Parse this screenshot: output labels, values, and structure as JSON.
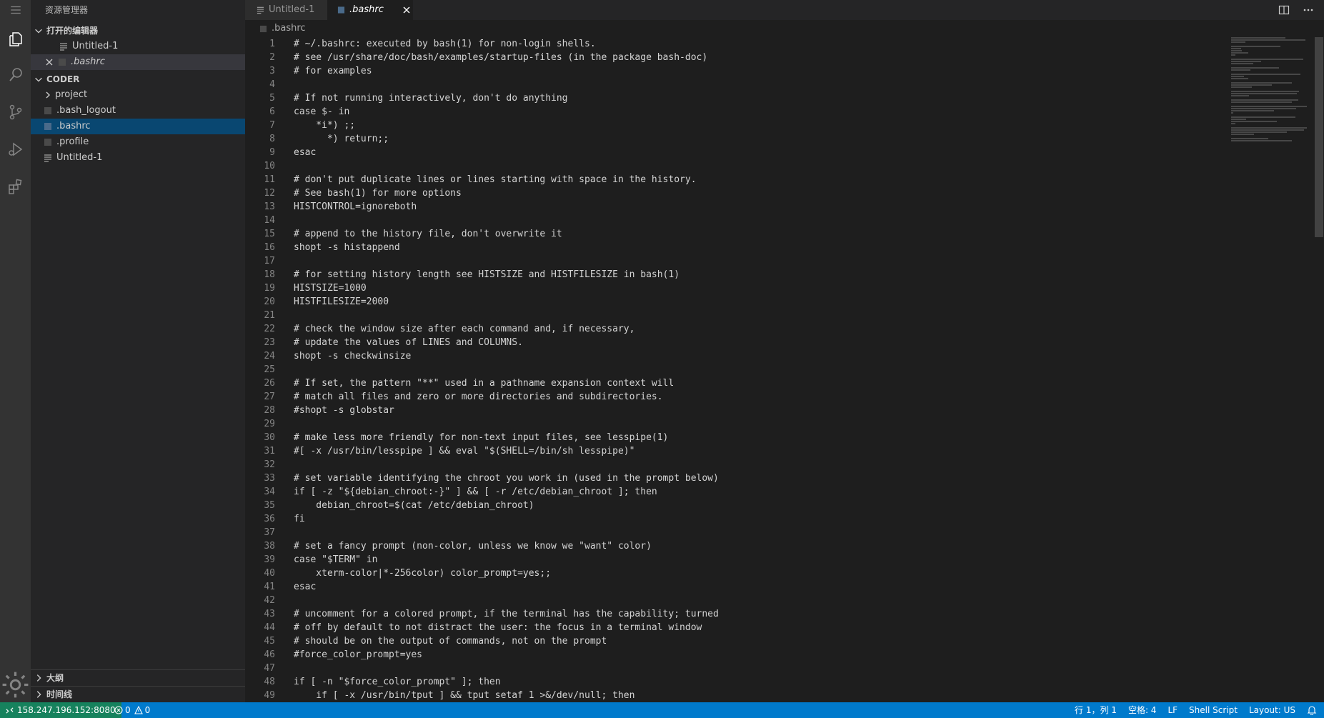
{
  "explorer": {
    "title": "资源管理器",
    "open_editors_label": "打开的编辑器",
    "open_editors": [
      {
        "name": "Untitled-1",
        "italic": false
      },
      {
        "name": ".bashrc",
        "italic": true
      }
    ],
    "workspace_label": "CODER",
    "files": [
      {
        "name": "project",
        "type": "folder"
      },
      {
        "name": ".bash_logout",
        "type": "file"
      },
      {
        "name": ".bashrc",
        "type": "file"
      },
      {
        "name": ".profile",
        "type": "file"
      },
      {
        "name": "Untitled-1",
        "type": "text"
      }
    ],
    "outline_label": "大纲",
    "timeline_label": "时间线"
  },
  "tabs": [
    {
      "label": "Untitled-1"
    },
    {
      "label": ".bashrc"
    }
  ],
  "breadcrumb": ".bashrc",
  "code_lines": [
    "# ~/.bashrc: executed by bash(1) for non-login shells.",
    "# see /usr/share/doc/bash/examples/startup-files (in the package bash-doc)",
    "# for examples",
    "",
    "# If not running interactively, don't do anything",
    "case $- in",
    "    *i*) ;;",
    "      *) return;;",
    "esac",
    "",
    "# don't put duplicate lines or lines starting with space in the history.",
    "# See bash(1) for more options",
    "HISTCONTROL=ignoreboth",
    "",
    "# append to the history file, don't overwrite it",
    "shopt -s histappend",
    "",
    "# for setting history length see HISTSIZE and HISTFILESIZE in bash(1)",
    "HISTSIZE=1000",
    "HISTFILESIZE=2000",
    "",
    "# check the window size after each command and, if necessary,",
    "# update the values of LINES and COLUMNS.",
    "shopt -s checkwinsize",
    "",
    "# If set, the pattern \"**\" used in a pathname expansion context will",
    "# match all files and zero or more directories and subdirectories.",
    "#shopt -s globstar",
    "",
    "# make less more friendly for non-text input files, see lesspipe(1)",
    "#[ -x /usr/bin/lesspipe ] && eval \"$(SHELL=/bin/sh lesspipe)\"",
    "",
    "# set variable identifying the chroot you work in (used in the prompt below)",
    "if [ -z \"${debian_chroot:-}\" ] && [ -r /etc/debian_chroot ]; then",
    "    debian_chroot=$(cat /etc/debian_chroot)",
    "fi",
    "",
    "# set a fancy prompt (non-color, unless we know we \"want\" color)",
    "case \"$TERM\" in",
    "    xterm-color|*-256color) color_prompt=yes;;",
    "esac",
    "",
    "# uncomment for a colored prompt, if the terminal has the capability; turned",
    "# off by default to not distract the user: the focus in a terminal window",
    "# should be on the output of commands, not on the prompt",
    "#force_color_prompt=yes",
    "",
    "if [ -n \"$force_color_prompt\" ]; then",
    "    if [ -x /usr/bin/tput ] && tput setaf 1 >&/dev/null; then"
  ],
  "status": {
    "remote": "158.247.196.152:8080",
    "errors": "0",
    "warnings": "0",
    "position": "行 1，列 1",
    "spaces": "空格: 4",
    "eol": "LF",
    "language": "Shell Script",
    "layout": "Layout: US"
  },
  "colors": {
    "accent": "#007acc",
    "remote": "#16825d",
    "selection": "#094771"
  }
}
